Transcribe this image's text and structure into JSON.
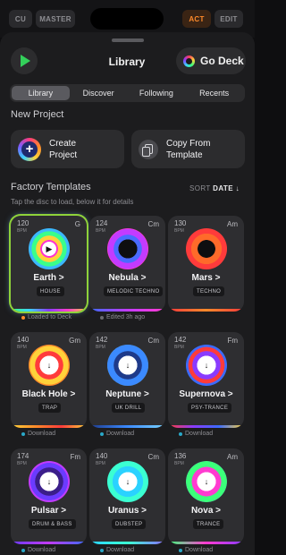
{
  "topbar": {
    "cu": "CU",
    "master": "MASTER",
    "act": "ACT",
    "edit": "EDIT"
  },
  "header": {
    "title": "Library",
    "go_deck": "Go Deck"
  },
  "tabs": [
    {
      "label": "Library",
      "active": true
    },
    {
      "label": "Discover",
      "active": false
    },
    {
      "label": "Following",
      "active": false
    },
    {
      "label": "Recents",
      "active": false
    }
  ],
  "new_project": {
    "title": "New Project",
    "create": "Create\nProject",
    "copy": "Copy From\nTemplate"
  },
  "factory": {
    "title": "Factory Templates",
    "sort_label": "SORT",
    "sort_value": "DATE ↓",
    "hint": "Tap the disc to load, below it for details"
  },
  "templates": [
    {
      "bpm": "120",
      "bpm_unit": "BPM",
      "key": "G",
      "name": "Earth >",
      "genre": "HOUSE",
      "status": "Loaded to Deck",
      "status_color": "#ff8a2a"
    },
    {
      "bpm": "124",
      "bpm_unit": "BPM",
      "key": "Cm",
      "name": "Nebula >",
      "genre": "MELODIC TECHNO",
      "status": "Edited 3h ago",
      "status_color": "#6b6b70"
    },
    {
      "bpm": "130",
      "bpm_unit": "BPM",
      "key": "Am",
      "name": "Mars >",
      "genre": "TECHNO",
      "status": "",
      "status_color": ""
    },
    {
      "bpm": "140",
      "bpm_unit": "BPM",
      "key": "Gm",
      "name": "Black Hole >",
      "genre": "TRAP",
      "status": "Download",
      "status_color": "#2aa8c8"
    },
    {
      "bpm": "142",
      "bpm_unit": "BPM",
      "key": "Cm",
      "name": "Neptune >",
      "genre": "UK DRILL",
      "status": "Download",
      "status_color": "#2aa8c8"
    },
    {
      "bpm": "142",
      "bpm_unit": "BPM",
      "key": "Fm",
      "name": "Supernova >",
      "genre": "PSY-TRANCE",
      "status": "Download",
      "status_color": "#2aa8c8"
    },
    {
      "bpm": "174",
      "bpm_unit": "BPM",
      "key": "Fm",
      "name": "Pulsar >",
      "genre": "DRUM & BASS",
      "status": "Download",
      "status_color": "#2aa8c8"
    },
    {
      "bpm": "140",
      "bpm_unit": "BPM",
      "key": "Cm",
      "name": "Uranus >",
      "genre": "DUBSTEP",
      "status": "Download",
      "status_color": "#2aa8c8"
    },
    {
      "bpm": "136",
      "bpm_unit": "BPM",
      "key": "Am",
      "name": "Nova >",
      "genre": "TRANCE",
      "status": "Download",
      "status_color": "#2aa8c8"
    }
  ],
  "colors": {
    "accent_green": "#33d05a",
    "accent_orange": "#ff8a2a",
    "download_dot": "#2aa8c8"
  }
}
